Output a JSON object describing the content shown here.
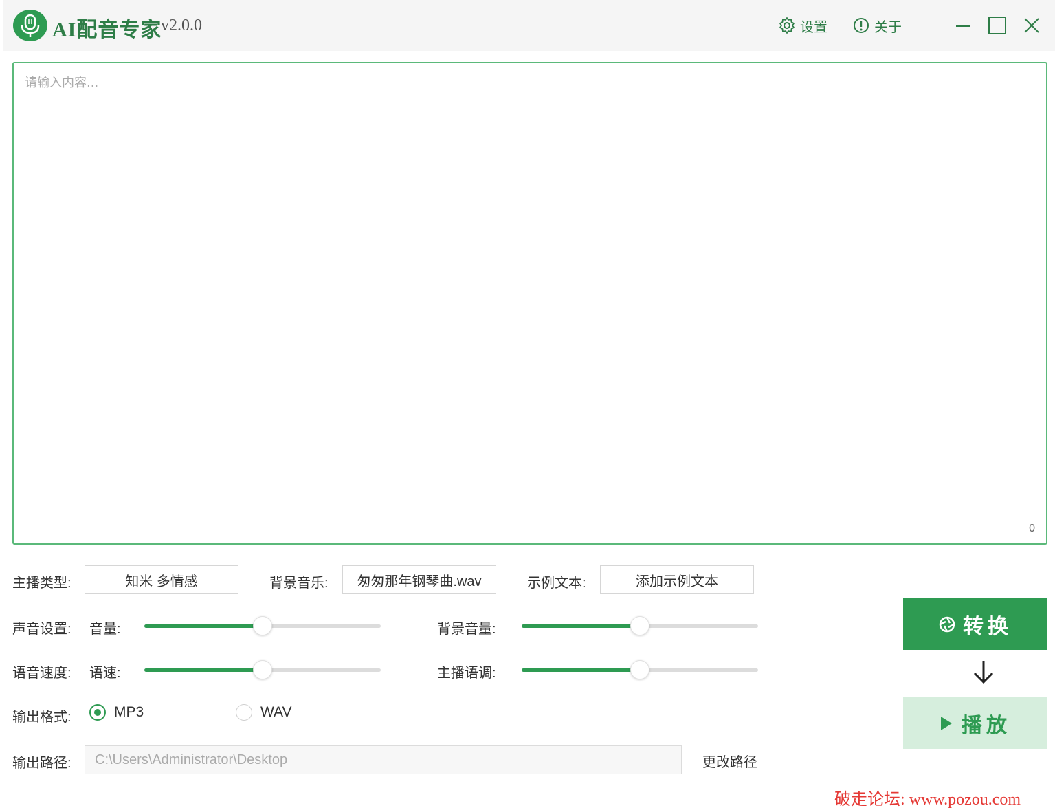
{
  "app": {
    "title": "AI配音专家",
    "version": "v2.0.0",
    "settings_label": "设置",
    "about_label": "关于",
    "accent_color": "#2e9b52",
    "icons": [
      "microphone-icon",
      "gear-icon",
      "info-icon",
      "minimize-icon",
      "maximize-icon",
      "close-icon"
    ]
  },
  "editor": {
    "placeholder": "请输入内容...",
    "char_count": "0"
  },
  "anchor_type": {
    "label": "主播类型:",
    "value": "知米 多情感"
  },
  "bg_music": {
    "label": "背景音乐:",
    "value": "匆匆那年钢琴曲.wav"
  },
  "sample_text": {
    "label": "示例文本:",
    "value": "添加示例文本"
  },
  "voice_settings": {
    "label": "声音设置:",
    "volume_label": "音量:",
    "volume_level": 0.5,
    "bg_volume_label": "背景音量:",
    "bg_volume_level": 0.5
  },
  "speech_speed": {
    "label": "语音速度:",
    "speed_label": "语速:",
    "speed_level": 0.5,
    "pitch_label": "主播语调:",
    "pitch_level": 0.5
  },
  "output_format": {
    "label": "输出格式:",
    "options": [
      "MP3",
      "WAV"
    ],
    "selected": "MP3"
  },
  "output_path": {
    "label": "输出路径:",
    "value": "C:\\Users\\Administrator\\Desktop",
    "change_label": "更改路径"
  },
  "actions": {
    "convert_label": "转换",
    "play_label": "播放"
  },
  "watermark": "破走论坛: www.pozou.com"
}
